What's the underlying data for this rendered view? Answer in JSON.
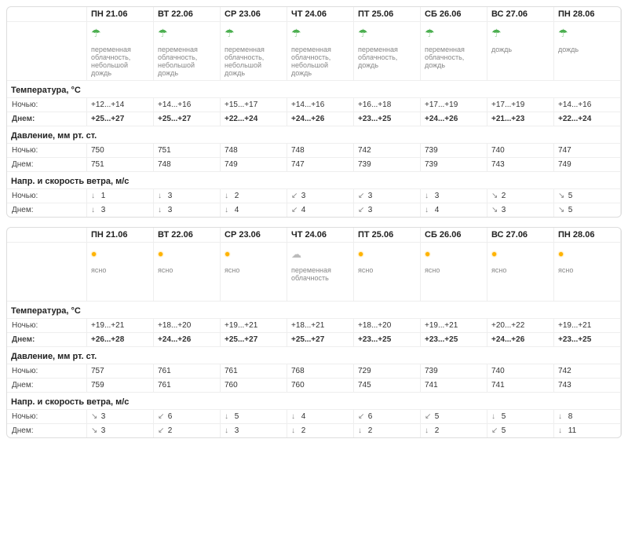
{
  "labels": {
    "temp_section": "Температура, °C",
    "night": "Ночью:",
    "day": "Днем:",
    "pressure_section": "Давление, мм рт. ст.",
    "wind_section": "Напр. и скорость ветра, м/с"
  },
  "blocks": [
    {
      "days": [
        {
          "dow": "ПН",
          "date": "21.06",
          "icon": "umbrella",
          "desc": "переменная облачность, небольшой дождь"
        },
        {
          "dow": "ВТ",
          "date": "22.06",
          "icon": "umbrella",
          "desc": "переменная облачность, небольшой дождь"
        },
        {
          "dow": "СР",
          "date": "23.06",
          "icon": "umbrella",
          "desc": "переменная облачность, небольшой дождь"
        },
        {
          "dow": "ЧТ",
          "date": "24.06",
          "icon": "umbrella",
          "desc": "переменная облачность, небольшой дождь"
        },
        {
          "dow": "ПТ",
          "date": "25.06",
          "icon": "umbrella",
          "desc": "переменная облачность, дождь"
        },
        {
          "dow": "СБ",
          "date": "26.06",
          "icon": "umbrella",
          "desc": "переменная облачность, дождь"
        },
        {
          "dow": "ВС",
          "date": "27.06",
          "icon": "umbrella",
          "desc": "дождь"
        },
        {
          "dow": "ПН",
          "date": "28.06",
          "icon": "umbrella",
          "desc": "дождь"
        }
      ],
      "temp_night": [
        "+12...+14",
        "+14...+16",
        "+15...+17",
        "+14...+16",
        "+16...+18",
        "+17...+19",
        "+17...+19",
        "+14...+16"
      ],
      "temp_day": [
        "+25...+27",
        "+25...+27",
        "+22...+24",
        "+24...+26",
        "+23...+25",
        "+24...+26",
        "+21...+23",
        "+22...+24"
      ],
      "press_night": [
        "750",
        "751",
        "748",
        "748",
        "742",
        "739",
        "740",
        "747"
      ],
      "press_day": [
        "751",
        "748",
        "749",
        "747",
        "739",
        "739",
        "743",
        "749"
      ],
      "wind_night": [
        {
          "a": "↓",
          "s": "1"
        },
        {
          "a": "↓",
          "s": "3"
        },
        {
          "a": "↓",
          "s": "2"
        },
        {
          "a": "↙",
          "s": "3"
        },
        {
          "a": "↙",
          "s": "3"
        },
        {
          "a": "↓",
          "s": "3"
        },
        {
          "a": "↘",
          "s": "2"
        },
        {
          "a": "↘",
          "s": "5"
        }
      ],
      "wind_day": [
        {
          "a": "↓",
          "s": "3"
        },
        {
          "a": "↓",
          "s": "3"
        },
        {
          "a": "↓",
          "s": "4"
        },
        {
          "a": "↙",
          "s": "4"
        },
        {
          "a": "↙",
          "s": "3"
        },
        {
          "a": "↓",
          "s": "4"
        },
        {
          "a": "↘",
          "s": "3"
        },
        {
          "a": "↘",
          "s": "5"
        }
      ]
    },
    {
      "days": [
        {
          "dow": "ПН",
          "date": "21.06",
          "icon": "sun",
          "desc": "ясно"
        },
        {
          "dow": "ВТ",
          "date": "22.06",
          "icon": "sun",
          "desc": "ясно"
        },
        {
          "dow": "СР",
          "date": "23.06",
          "icon": "sun",
          "desc": "ясно"
        },
        {
          "dow": "ЧТ",
          "date": "24.06",
          "icon": "cloud",
          "desc": "переменная облачность"
        },
        {
          "dow": "ПТ",
          "date": "25.06",
          "icon": "sun",
          "desc": "ясно"
        },
        {
          "dow": "СБ",
          "date": "26.06",
          "icon": "sun",
          "desc": "ясно"
        },
        {
          "dow": "ВС",
          "date": "27.06",
          "icon": "sun",
          "desc": "ясно"
        },
        {
          "dow": "ПН",
          "date": "28.06",
          "icon": "sun",
          "desc": "ясно"
        }
      ],
      "temp_night": [
        "+19...+21",
        "+18...+20",
        "+19...+21",
        "+18...+21",
        "+18...+20",
        "+19...+21",
        "+20...+22",
        "+19...+21"
      ],
      "temp_day": [
        "+26...+28",
        "+24...+26",
        "+25...+27",
        "+25...+27",
        "+23...+25",
        "+23...+25",
        "+24...+26",
        "+23...+25"
      ],
      "press_night": [
        "757",
        "761",
        "761",
        "768",
        "729",
        "739",
        "740",
        "742"
      ],
      "press_day": [
        "759",
        "761",
        "760",
        "760",
        "745",
        "741",
        "741",
        "743"
      ],
      "wind_night": [
        {
          "a": "↘",
          "s": "3"
        },
        {
          "a": "↙",
          "s": "6"
        },
        {
          "a": "↓",
          "s": "5"
        },
        {
          "a": "↓",
          "s": "4"
        },
        {
          "a": "↙",
          "s": "6"
        },
        {
          "a": "↙",
          "s": "5"
        },
        {
          "a": "↓",
          "s": "5"
        },
        {
          "a": "↓",
          "s": "8"
        }
      ],
      "wind_day": [
        {
          "a": "↘",
          "s": "3"
        },
        {
          "a": "↙",
          "s": "2"
        },
        {
          "a": "↓",
          "s": "3"
        },
        {
          "a": "↓",
          "s": "2"
        },
        {
          "a": "↓",
          "s": "2"
        },
        {
          "a": "↓",
          "s": "2"
        },
        {
          "a": "↙",
          "s": "5"
        },
        {
          "a": "↓",
          "s": "11"
        }
      ]
    }
  ]
}
